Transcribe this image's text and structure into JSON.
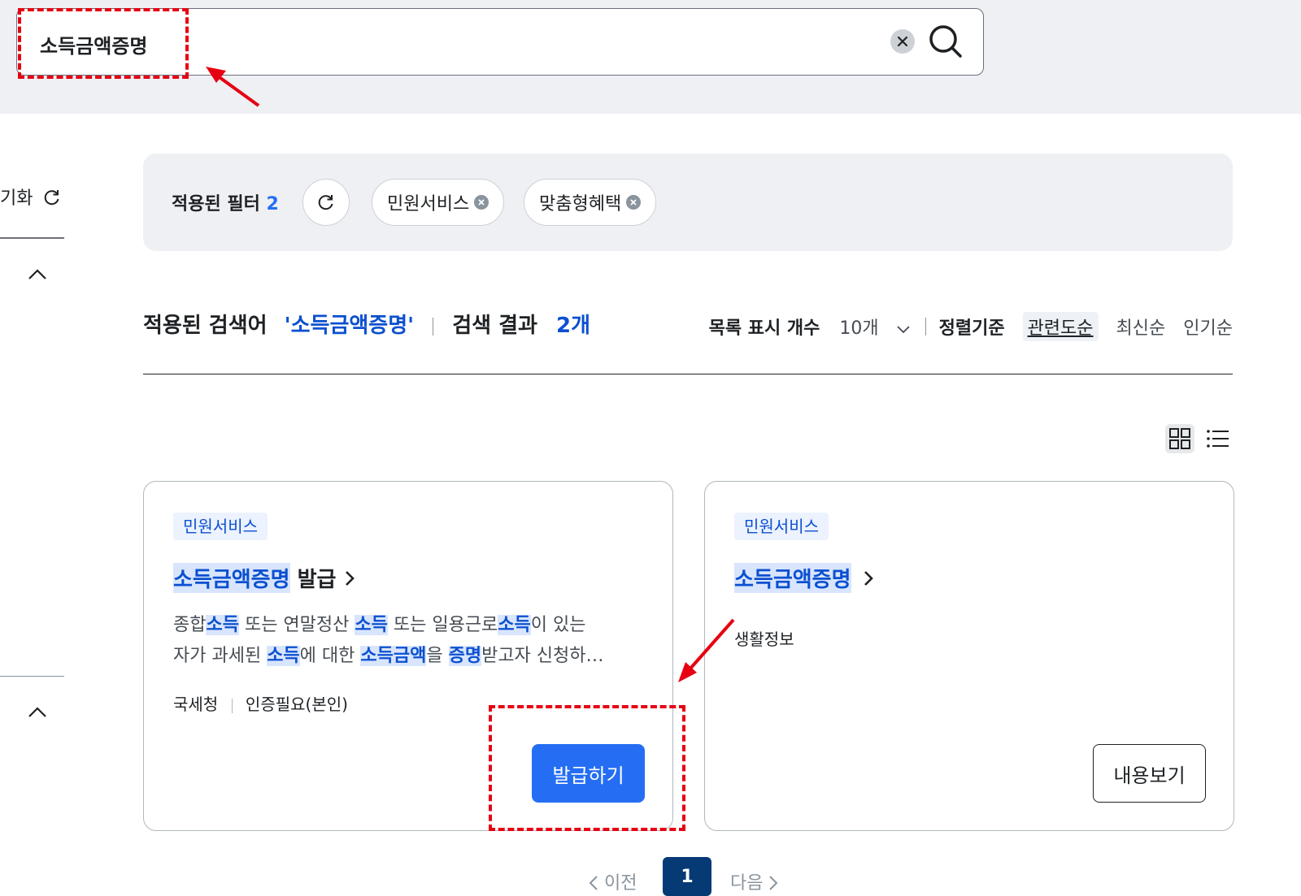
{
  "search": {
    "query": "소득금액증명"
  },
  "sidebar": {
    "reset_label": "기화"
  },
  "filters": {
    "label": "적용된 필터",
    "count": "2",
    "chips": [
      "민원서비스",
      "맞춤형혜택"
    ]
  },
  "results_header": {
    "applied_query_label": "적용된 검색어",
    "applied_query": "'소득금액증명'",
    "result_label": "검색 결과",
    "result_count": "2개",
    "page_size_label": "목록 표시 개수",
    "page_size_value": "10개",
    "sort_label": "정렬기준",
    "sort_options": [
      "관련도순",
      "최신순",
      "인기순"
    ],
    "active_sort": "관련도순"
  },
  "cards": [
    {
      "tag": "민원서비스",
      "title_highlight": "소득금액증명",
      "title_rest": " 발급",
      "desc_line1": [
        "종합",
        "소득",
        " 또는 연말정산 ",
        "소득",
        " 또는 일용근로",
        "소득",
        "이 있는"
      ],
      "desc_line2": [
        "자가 과세된 ",
        "소득",
        "에 대한 ",
        "소득금액",
        "을 ",
        "증명",
        "받고자 신청하…"
      ],
      "agency": "국세청",
      "auth": "인증필요(본인)",
      "button": "발급하기"
    },
    {
      "tag": "민원서비스",
      "title_highlight": "소득금액증명",
      "title_rest": "",
      "subtitle": "생활정보",
      "button": "내용보기"
    }
  ],
  "pagination": {
    "prev": "이전",
    "current": "1",
    "next": "다음"
  },
  "colors": {
    "primary": "#256ef4",
    "highlight_text": "#0b50d0",
    "annotation": "#e60012",
    "page_bg": "#eef0f4"
  }
}
